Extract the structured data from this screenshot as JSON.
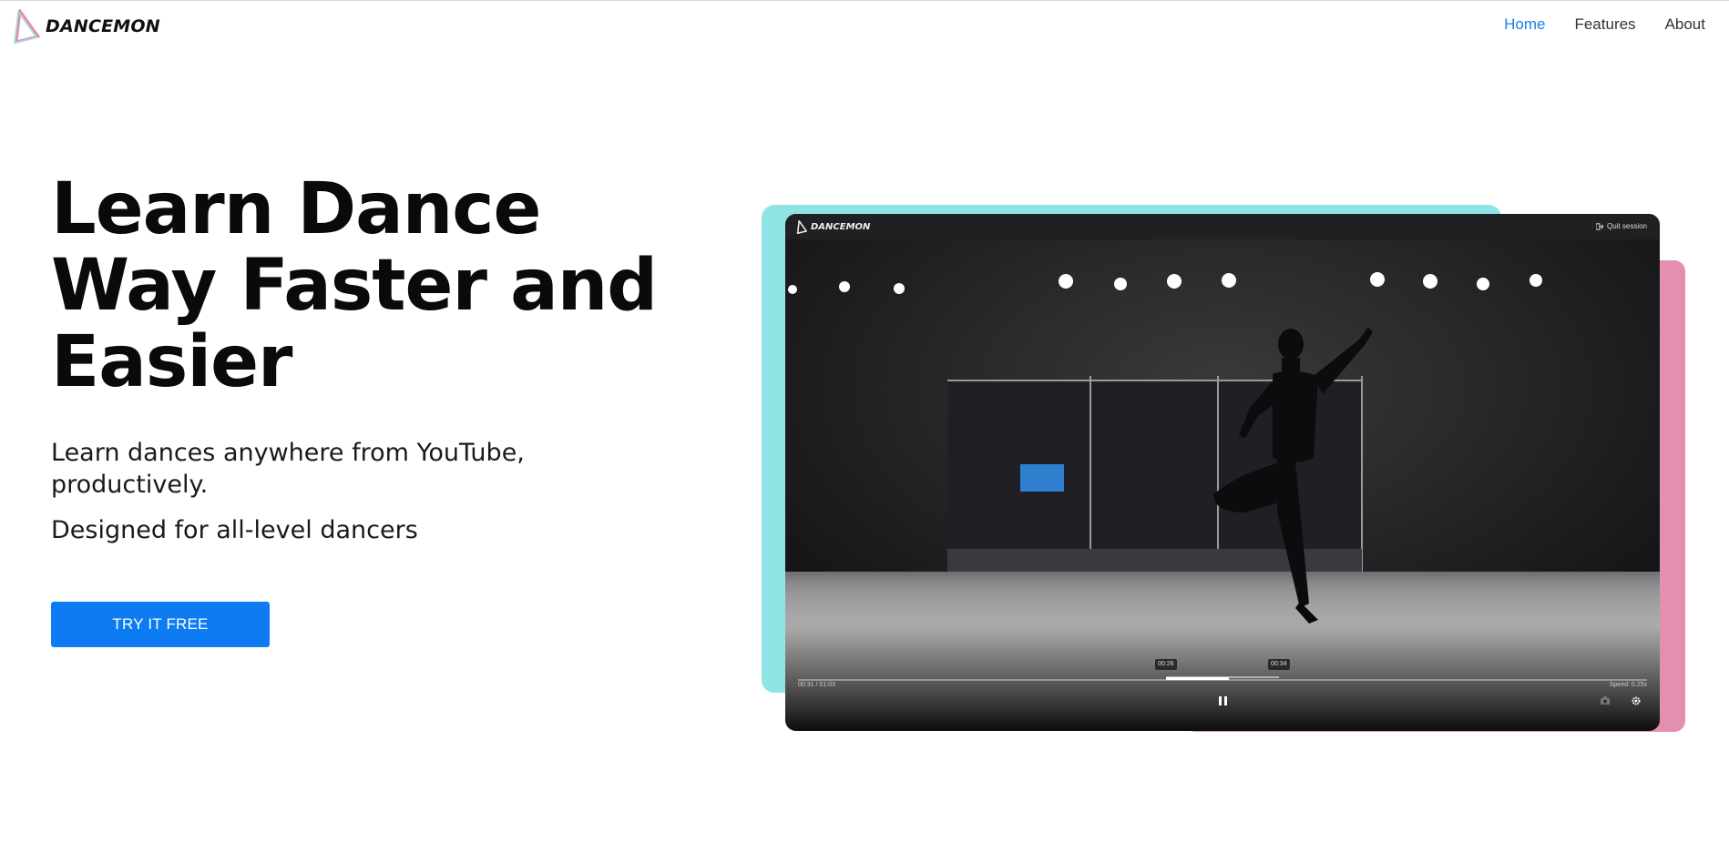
{
  "brand": {
    "name": "DANCEMON"
  },
  "nav": {
    "items": [
      {
        "label": "Home",
        "active": true
      },
      {
        "label": "Features",
        "active": false
      },
      {
        "label": "About",
        "active": false
      }
    ]
  },
  "hero": {
    "title_lines": [
      "Learn Dance",
      "Way Faster and",
      "Easier"
    ],
    "subtitle": "Learn dances anywhere from YouTube, productively.",
    "subtitle2": "Designed for all-level dancers",
    "cta_label": "TRY IT FREE"
  },
  "player": {
    "brand": "DANCEMON",
    "quit_label": "Quit session",
    "loop_start": "00:26",
    "loop_end": "00:34",
    "time": "00:31 / 01:03",
    "speed": "Speed: 0.25x",
    "progress": 0.56
  },
  "colors": {
    "accent": "#0d7cf2",
    "nav_active": "#1a7fe6",
    "cyan_block": "#8fe5e5",
    "pink_block": "#e48fb0"
  },
  "icons": {
    "logo": "dancemon-logo-icon",
    "quit": "exit-icon",
    "pause": "pause-icon",
    "camera": "camera-icon",
    "settings": "gear-icon"
  }
}
